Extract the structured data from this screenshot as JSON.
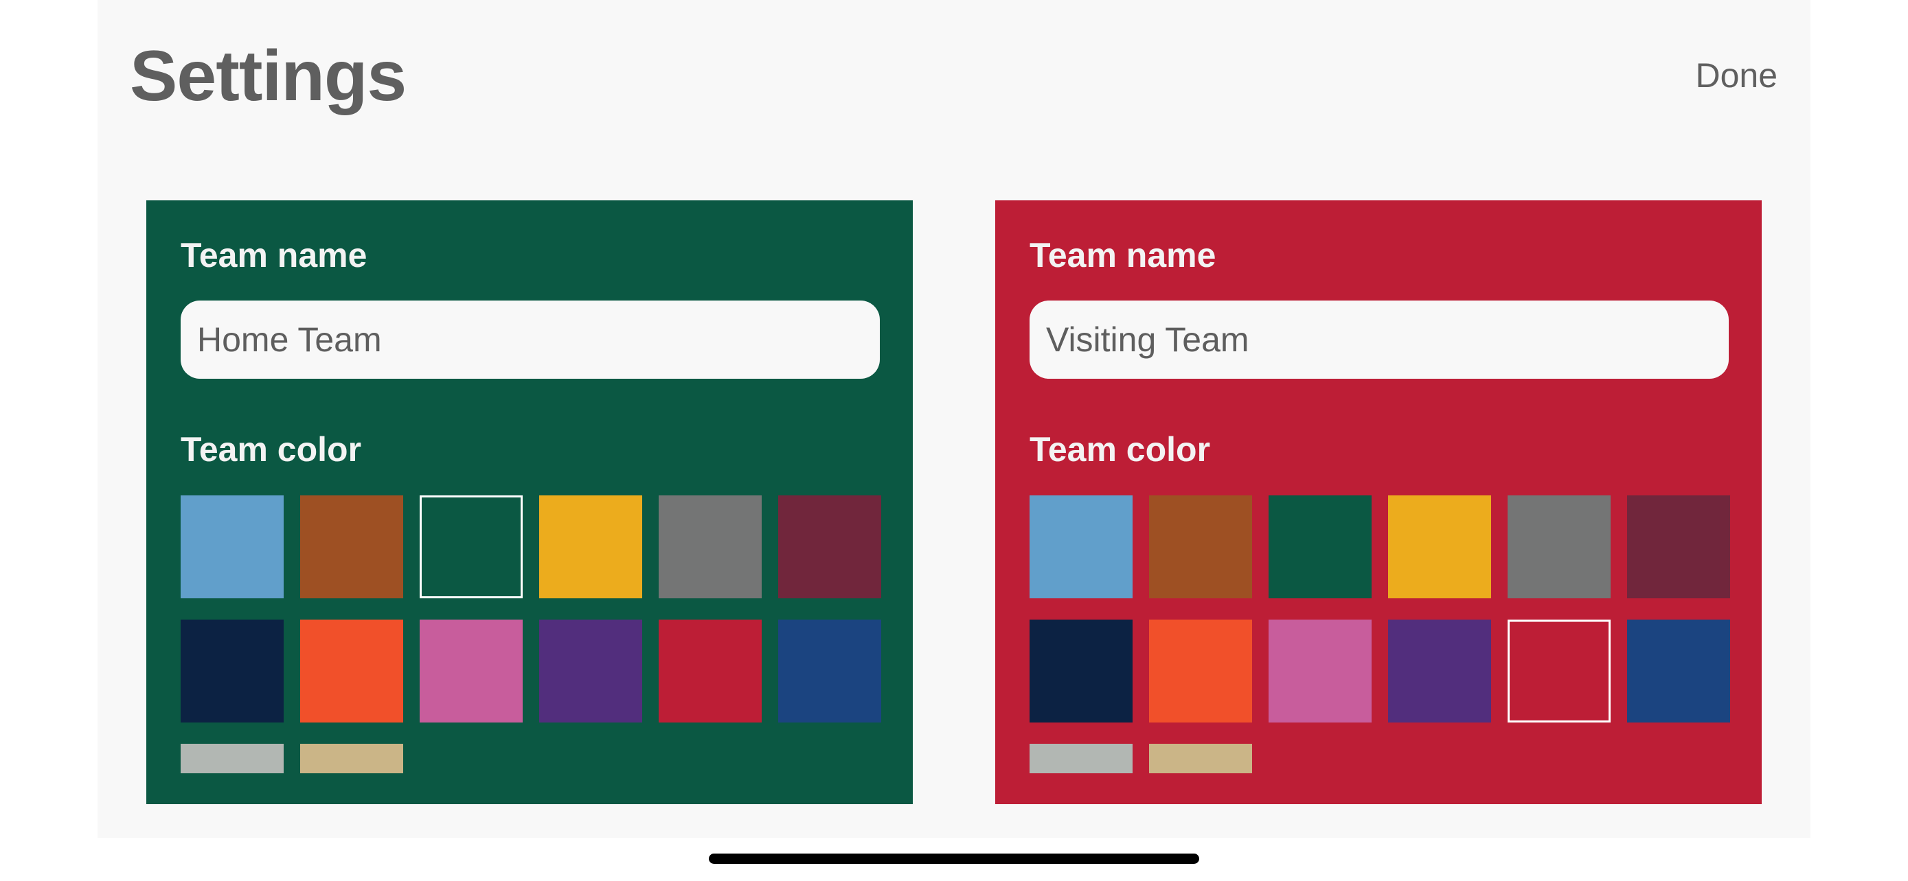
{
  "header": {
    "title": "Settings",
    "done_label": "Done"
  },
  "teams": [
    {
      "team_name_label": "Team name",
      "team_name_value": "Home Team",
      "team_color_label": "Team color",
      "background": "#0b5843",
      "selected_color": "dark-green"
    },
    {
      "team_name_label": "Team name",
      "team_name_value": "Visiting Team",
      "team_color_label": "Team color",
      "background": "#bd1e36",
      "selected_color": "red"
    }
  ],
  "palette": [
    {
      "name": "light-blue",
      "hex": "#619fcb"
    },
    {
      "name": "brown",
      "hex": "#9e5023"
    },
    {
      "name": "dark-green",
      "hex": "#0b5843"
    },
    {
      "name": "yellow",
      "hex": "#ecac1d"
    },
    {
      "name": "gray",
      "hex": "#747575"
    },
    {
      "name": "maroon",
      "hex": "#71263c"
    },
    {
      "name": "navy",
      "hex": "#0c2243"
    },
    {
      "name": "orange",
      "hex": "#f1502a"
    },
    {
      "name": "pink",
      "hex": "#c85d9c"
    },
    {
      "name": "purple",
      "hex": "#522e7d"
    },
    {
      "name": "red",
      "hex": "#bd1e36"
    },
    {
      "name": "blue",
      "hex": "#1b4480"
    },
    {
      "name": "silver",
      "hex": "#b2b7b3"
    },
    {
      "name": "tan",
      "hex": "#cbb587"
    }
  ]
}
